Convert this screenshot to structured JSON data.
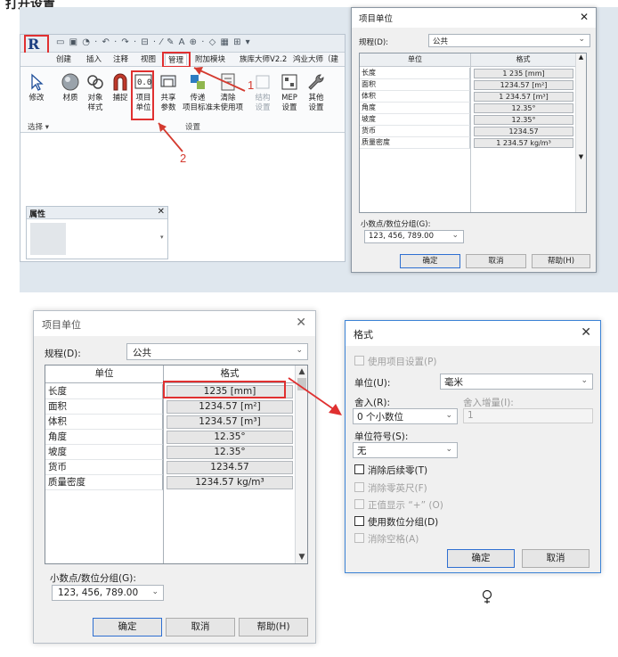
{
  "page_title": "打开设置",
  "revit": {
    "logo_text": "R",
    "tabs": [
      "创建",
      "插入",
      "注释",
      "视图",
      "管理",
      "附加模块",
      "族库大师V2.2",
      "鸿业大师（建"
    ],
    "active_tab": "管理",
    "ribbon_buttons": [
      {
        "label": "修改",
        "icon": "cursor-arrow-icon"
      },
      {
        "label": "材质",
        "icon": "material-sphere-icon"
      },
      {
        "label": "对象\n样式",
        "icon": "object-styles-icon"
      },
      {
        "label": "捕捉",
        "icon": "snap-magnet-icon"
      },
      {
        "label": "项目\n单位",
        "icon": "project-units-icon"
      },
      {
        "label": "共享\n参数",
        "icon": "shared-parameters-icon"
      },
      {
        "label": "传递\n项目标准",
        "icon": "transfer-standards-icon"
      },
      {
        "label": "清除\n未使用项",
        "icon": "purge-unused-icon"
      },
      {
        "label": "结构\n设置",
        "icon": "structural-settings-icon"
      },
      {
        "label": "MEP\n设置",
        "icon": "mep-settings-icon"
      },
      {
        "label": "其他\n设置",
        "icon": "wrench-icon"
      }
    ],
    "group_select": "选择 ▾",
    "group_settings": "设置",
    "properties_title": "属性"
  },
  "callouts": {
    "one": "1",
    "two": "2"
  },
  "small_dialog": {
    "title": "项目单位",
    "discipline_label": "规程(D):",
    "discipline_value": "公共",
    "col_unit": "单位",
    "col_format": "格式",
    "rows": [
      {
        "unit": "长度",
        "format": "1 235 [mm]"
      },
      {
        "unit": "面积",
        "format": "1234.57 [m²]"
      },
      {
        "unit": "体积",
        "format": "1 234.57 [m³]"
      },
      {
        "unit": "角度",
        "format": "12.35°"
      },
      {
        "unit": "坡度",
        "format": "12.35°"
      },
      {
        "unit": "货币",
        "format": "1234.57"
      },
      {
        "unit": "质量密度",
        "format": "1 234.57 kg/m³"
      }
    ],
    "grouping_label": "小数点/数位分组(G):",
    "grouping_value": "123, 456, 789.00",
    "ok": "确定",
    "cancel": "取消",
    "help": "帮助(H)"
  },
  "large_dialog": {
    "title": "项目单位",
    "discipline_label": "规程(D):",
    "discipline_value": "公共",
    "col_unit": "单位",
    "col_format": "格式",
    "rows": [
      {
        "unit": "长度",
        "format": "1235 [mm]"
      },
      {
        "unit": "面积",
        "format": "1234.57 [m²]"
      },
      {
        "unit": "体积",
        "format": "1234.57 [m³]"
      },
      {
        "unit": "角度",
        "format": "12.35°"
      },
      {
        "unit": "坡度",
        "format": "12.35°"
      },
      {
        "unit": "货币",
        "format": "1234.57"
      },
      {
        "unit": "质量密度",
        "format": "1234.57 kg/m³"
      }
    ],
    "grouping_label": "小数点/数位分组(G):",
    "grouping_value": "123, 456, 789.00",
    "ok": "确定",
    "cancel": "取消",
    "help": "帮助(H)"
  },
  "format_dialog": {
    "title": "格式",
    "use_project_settings": "使用项目设置(P)",
    "unit_label": "单位(U):",
    "unit_value": "毫米",
    "rounding_label": "舍入(R):",
    "rounding_value": "0 个小数位",
    "rounding_increment_label": "舍入增量(I):",
    "rounding_increment_value": "1",
    "unit_symbol_label": "单位符号(S):",
    "unit_symbol_value": "无",
    "suppress_trailing_zeros": "消除后续零(T)",
    "suppress_zero_feet": "消除零英尺(F)",
    "show_plus_sign": "正值显示 “+” (O)",
    "use_digit_grouping": "使用数位分组(D)",
    "suppress_spaces": "消除空格(A)",
    "ok": "确定",
    "cancel": "取消"
  },
  "colors": {
    "highlight": "#e03030",
    "accent": "#2e6fd1",
    "dialog_bg": "#f0f0f0"
  }
}
